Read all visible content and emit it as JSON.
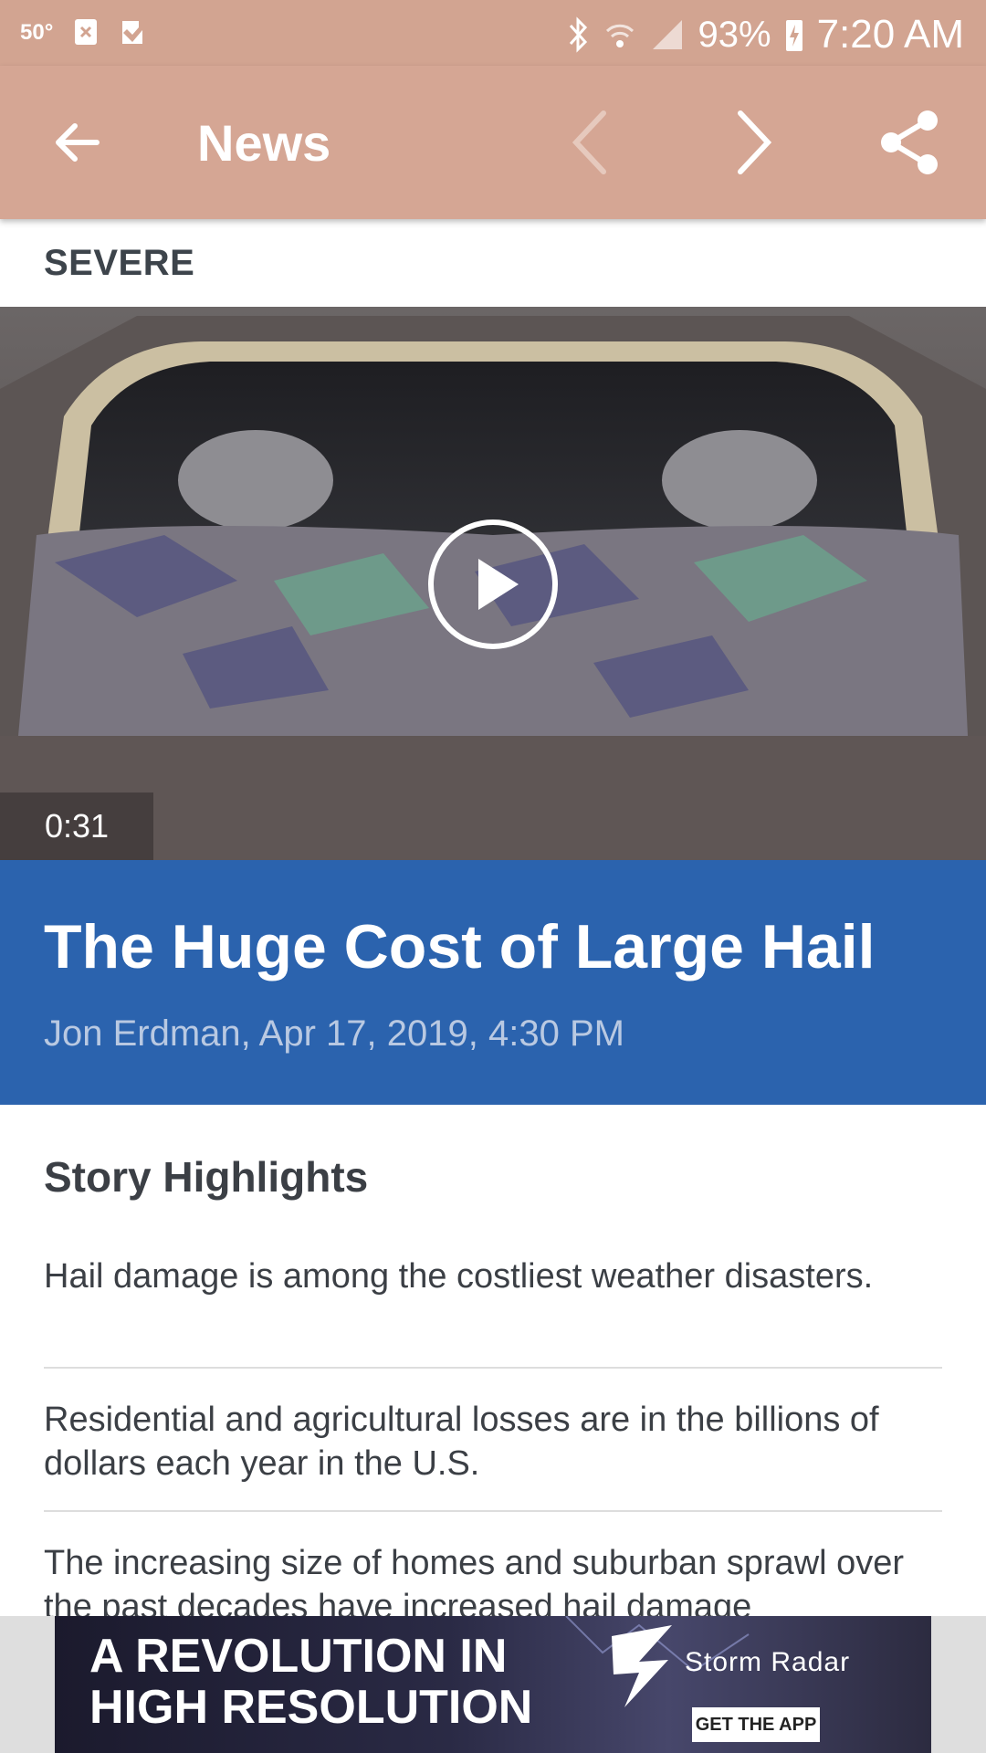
{
  "status_bar": {
    "temperature": "50°",
    "battery": "93%",
    "time": "7:20 AM"
  },
  "app_bar": {
    "title": "News"
  },
  "article": {
    "category": "SEVERE",
    "video_duration": "0:31",
    "title": "The Huge Cost of Large Hail",
    "byline": "Jon Erdman, Apr 17, 2019, 4:30 PM"
  },
  "highlights": {
    "title": "Story Highlights",
    "items": [
      "Hail damage is among the costliest weather disasters.",
      "Residential and agricultural losses are in the billions of dollars each year in the U.S.",
      "The increasing size of homes and suburban sprawl over the past decades have increased hail damage"
    ]
  },
  "ad": {
    "headline_line1": "A REVOLUTION IN",
    "headline_line2": "HIGH RESOLUTION",
    "brand": "Storm Radar",
    "cta": "GET THE APP"
  },
  "colors": {
    "app_bar": "#d5a694",
    "status_bar": "#d2a491",
    "headline_bg": "#2b63ae",
    "byline": "#b9c9e2"
  }
}
